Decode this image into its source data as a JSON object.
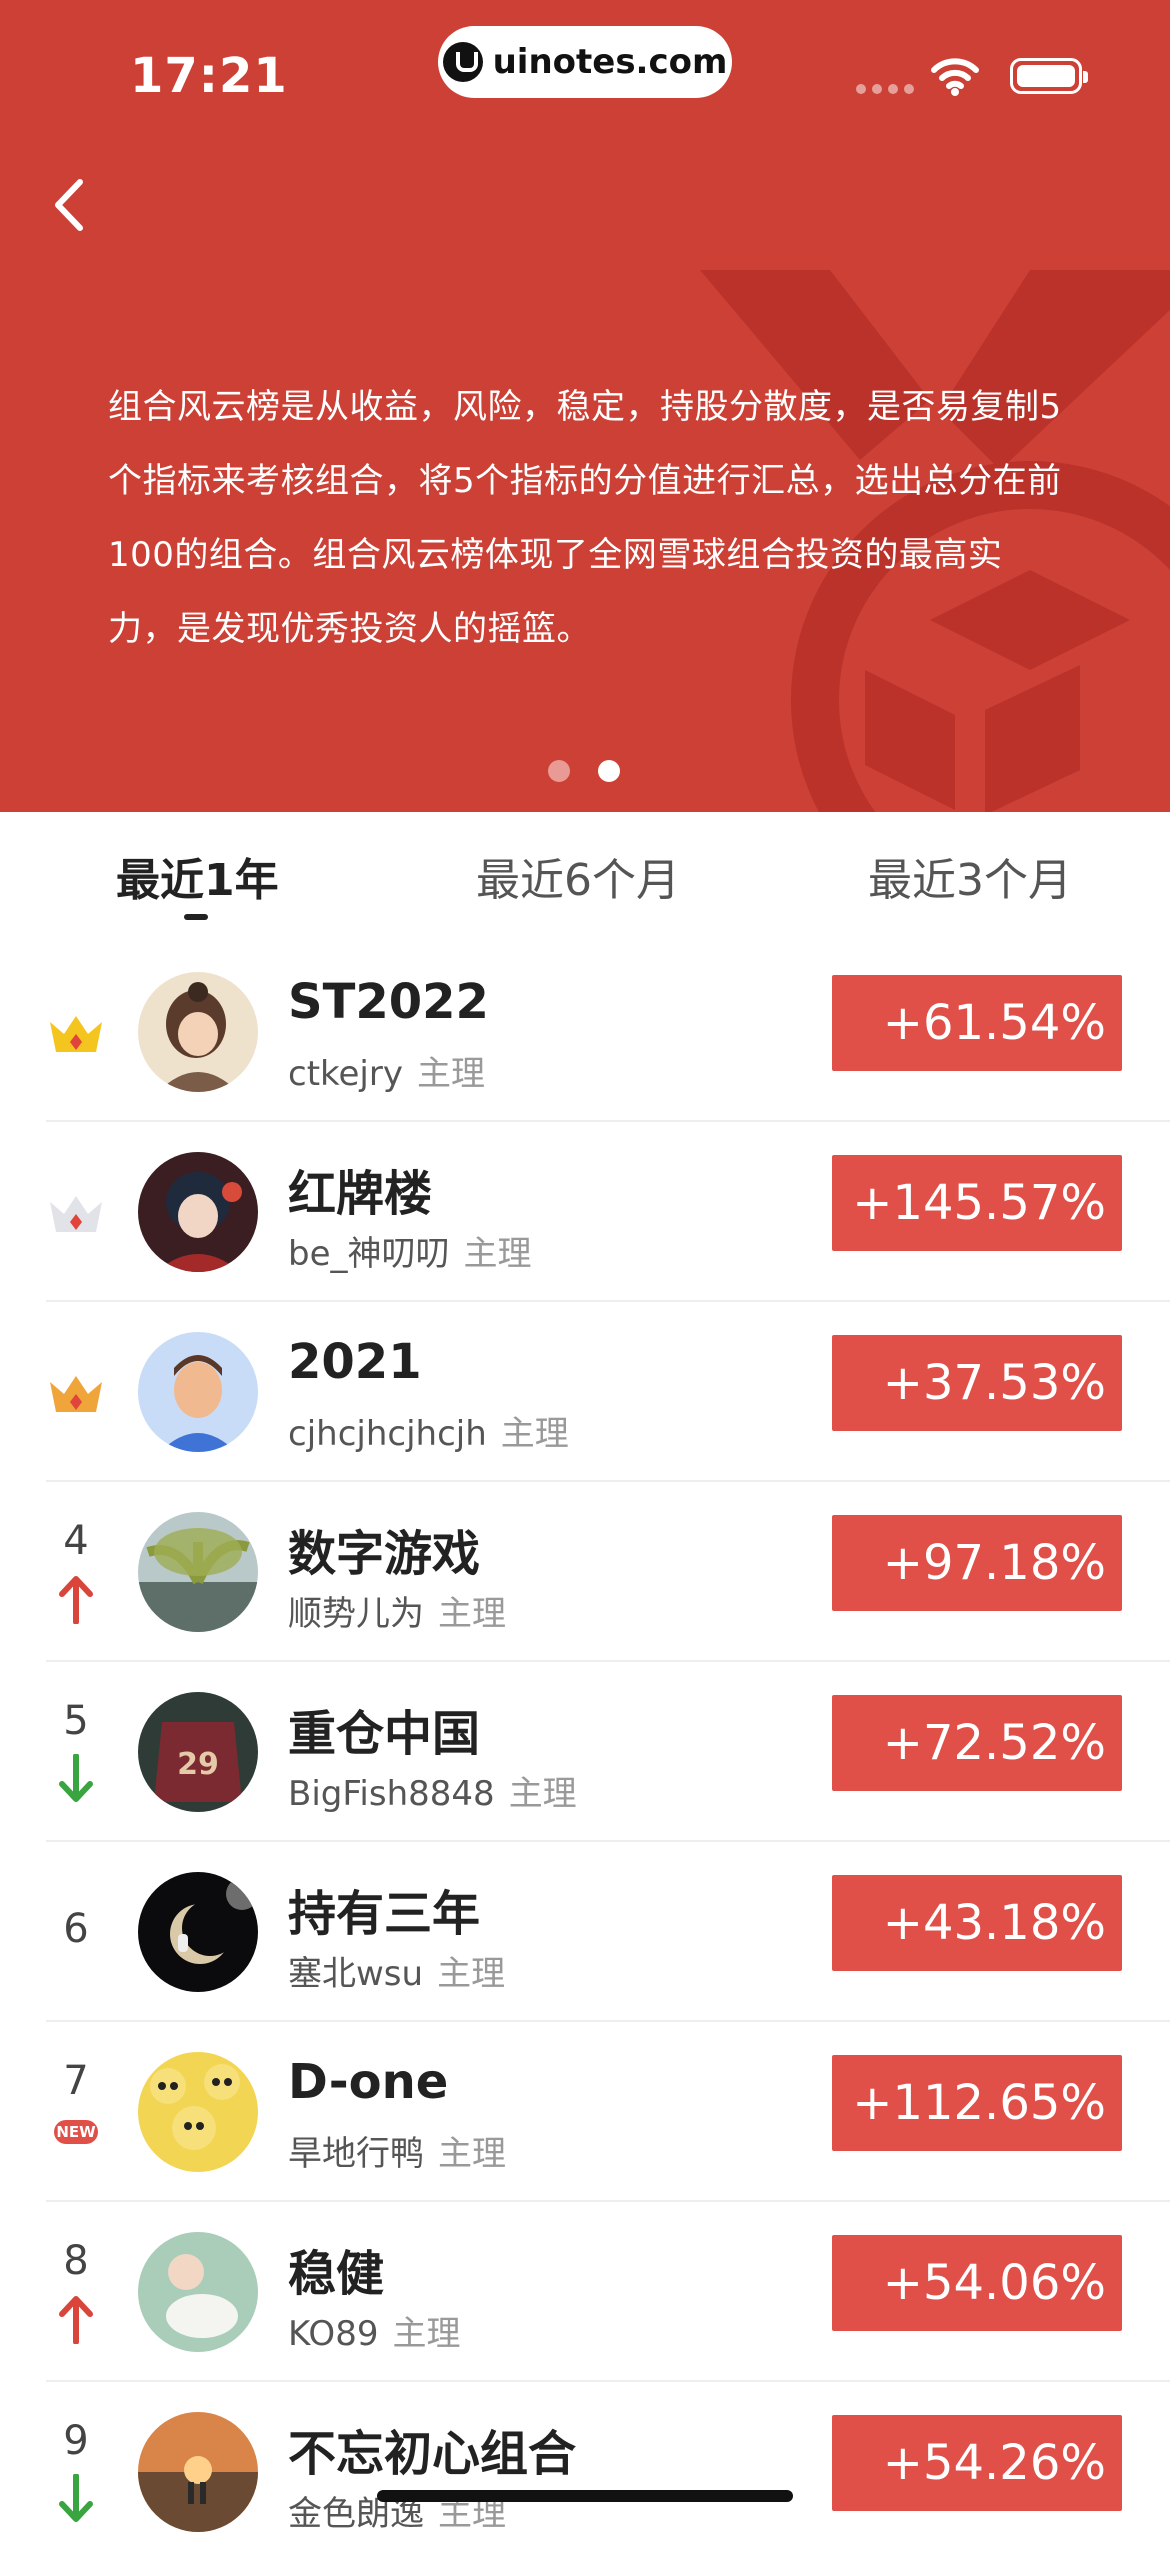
{
  "status_bar": {
    "time": "17:21",
    "url": "uinotes.com"
  },
  "header": {
    "description": "组合风云榜是从收益，风险，稳定，持股分散度，是否易复制5个指标来考核组合，将5个指标的分值进行汇总，选出总分在前100的组合。组合风云榜体现了全网雪球组合投资的最高实力，是发现优秀投资人的摇篮。",
    "carousel": {
      "total": 2,
      "active": 2
    }
  },
  "tabs": [
    {
      "label": "最近1年",
      "active": true
    },
    {
      "label": "最近6个月",
      "active": false
    },
    {
      "label": "最近3个月",
      "active": false
    }
  ],
  "role_label": "主理",
  "ranking": [
    {
      "rank": "1",
      "badge": "gold-crown-icon",
      "name": "ST2022",
      "owner": "ctkejry",
      "return": "+61.54%",
      "avatar": "avatar-girl"
    },
    {
      "rank": "2",
      "badge": "silver-crown-icon",
      "name": "红牌楼",
      "owner": "be_神叨叨",
      "return": "+145.57%",
      "avatar": "avatar-anime"
    },
    {
      "rank": "3",
      "badge": "bronze-crown-icon",
      "name": "2021",
      "owner": "cjhcjhcjhcjh",
      "return": "+37.53%",
      "avatar": "avatar-man"
    },
    {
      "rank": "4",
      "badge": "arrow-up-icon",
      "name": "数字游戏",
      "owner": "顺势儿为",
      "return": "+97.18%",
      "avatar": "avatar-willow"
    },
    {
      "rank": "5",
      "badge": "arrow-down-icon",
      "name": "重仓中国",
      "owner": "BigFish8848",
      "return": "+72.52%",
      "avatar": "avatar-jersey"
    },
    {
      "rank": "6",
      "badge": "",
      "name": "持有三年",
      "owner": "塞北wsu",
      "return": "+43.18%",
      "avatar": "avatar-moon"
    },
    {
      "rank": "7",
      "badge": "new-badge-icon",
      "badge_text": "NEW",
      "name": "D-one",
      "owner": "旱地行鸭",
      "return": "+112.65%",
      "avatar": "avatar-ducks"
    },
    {
      "rank": "8",
      "badge": "arrow-up-icon",
      "name": "稳健",
      "owner": "KO89",
      "return": "+54.06%",
      "avatar": "avatar-baby"
    },
    {
      "rank": "9",
      "badge": "arrow-down-icon",
      "name": "不忘初心组合",
      "owner": "金色朗逸",
      "return": "+54.26%",
      "avatar": "avatar-sunset"
    }
  ],
  "colors": {
    "header_bg": "#cc4036",
    "return_bg": "#e04f48",
    "up": "#d9443b",
    "down": "#3aa540"
  }
}
